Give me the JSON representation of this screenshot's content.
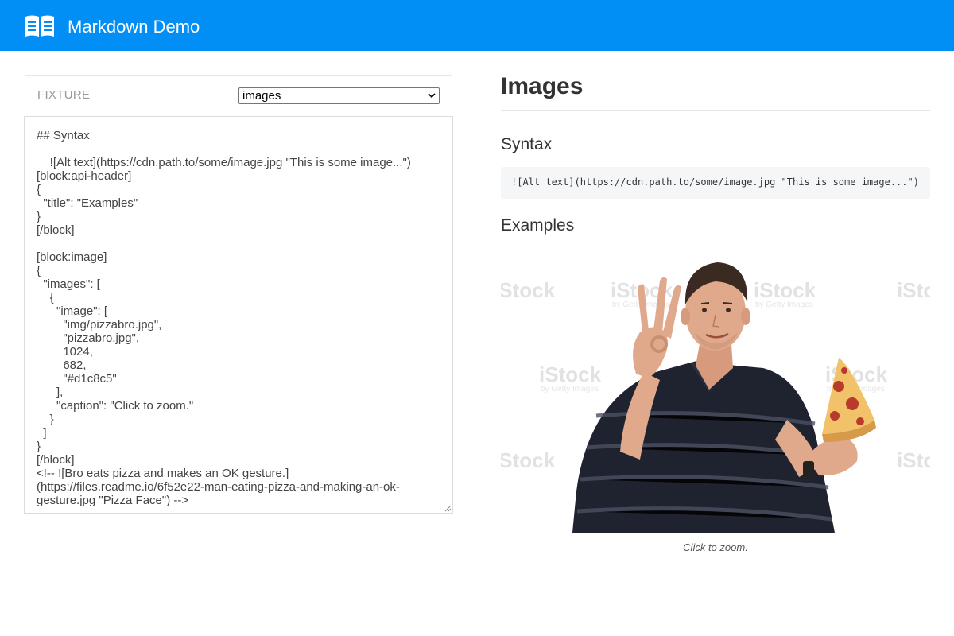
{
  "app": {
    "title": "Markdown Demo",
    "logo_icon": "open-book-icon",
    "brand_color": "#018ef5"
  },
  "fixture": {
    "label": "FIXTURE",
    "selected": "images"
  },
  "editor": {
    "content": "## Syntax\n\n    ![Alt text](https://cdn.path.to/some/image.jpg \"This is some image...\")\n[block:api-header]\n{\n  \"title\": \"Examples\"\n}\n[/block]\n\n[block:image]\n{\n  \"images\": [\n    {\n      \"image\": [\n        \"img/pizzabro.jpg\",\n        \"pizzabro.jpg\",\n        1024,\n        682,\n        \"#d1c8c5\"\n      ],\n      \"caption\": \"Click to zoom.\"\n    }\n  ]\n}\n[/block]\n<!-- ![Bro eats pizza and makes an OK gesture.](https://files.readme.io/6f52e22-man-eating-pizza-and-making-an-ok-gesture.jpg \"Pizza Face\") -->"
  },
  "preview": {
    "title": "Images",
    "syntax_heading": "Syntax",
    "syntax_code": "![Alt text](https://cdn.path.to/some/image.jpg \"This is some image...\")",
    "examples_heading": "Examples",
    "image": {
      "watermark": "iStock",
      "watermark_sub": "by Getty Images",
      "shirt_color": "#1f2330",
      "stripe_color": "#4a5060",
      "skin_color": "#e0a98c"
    },
    "caption": "Click to zoom."
  }
}
